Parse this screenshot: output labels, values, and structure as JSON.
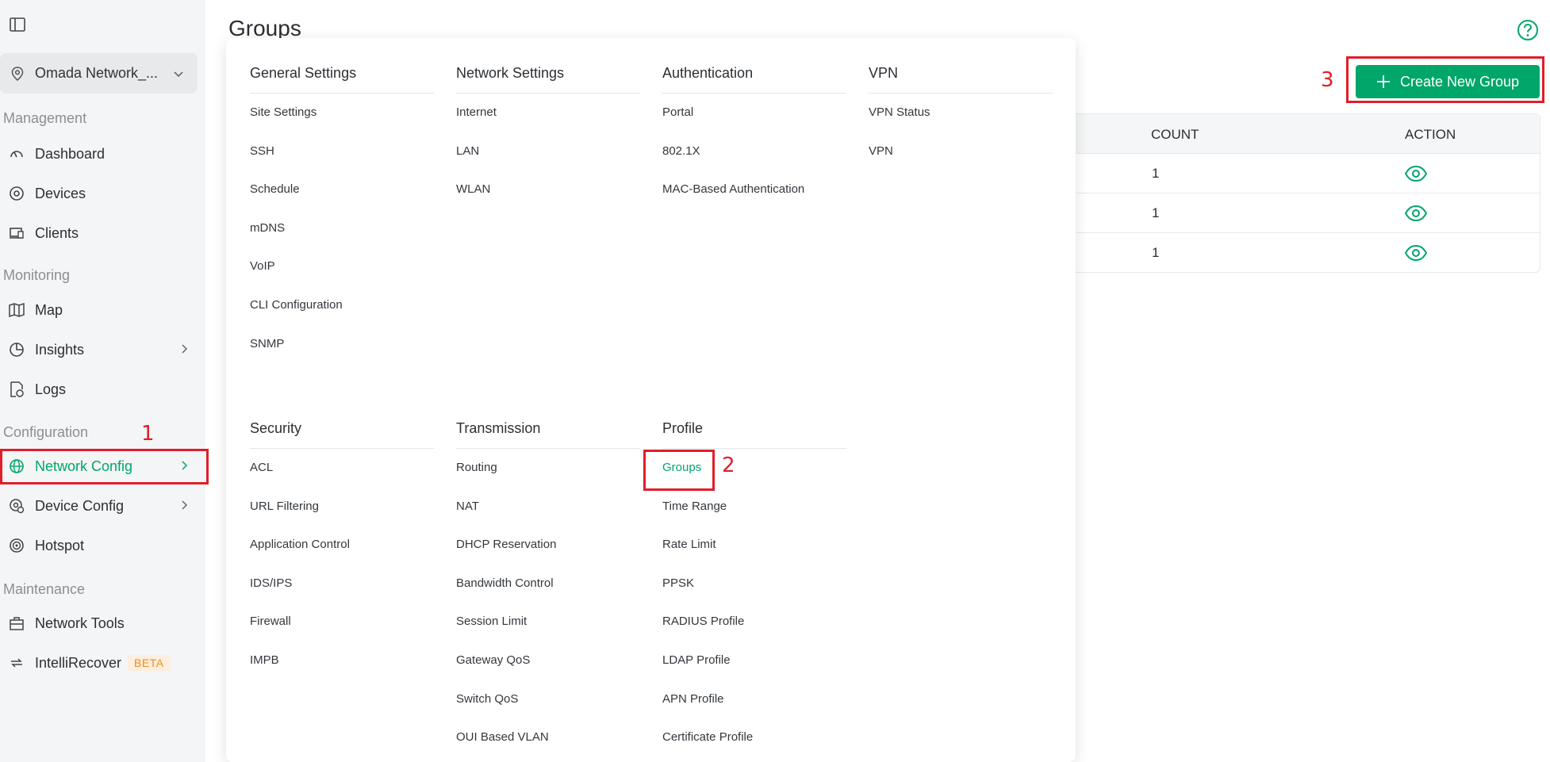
{
  "sidebar": {
    "site_name": "Omada Network_...",
    "sections": {
      "management": "Management",
      "monitoring": "Monitoring",
      "configuration": "Configuration",
      "maintenance": "Maintenance"
    },
    "items": {
      "dashboard": "Dashboard",
      "devices": "Devices",
      "clients": "Clients",
      "map": "Map",
      "insights": "Insights",
      "logs": "Logs",
      "network_config": "Network Config",
      "device_config": "Device Config",
      "hotspot": "Hotspot",
      "network_tools": "Network Tools",
      "intellirecover": "IntelliRecover",
      "beta": "BETA"
    }
  },
  "page": {
    "title": "Groups",
    "create_button": "Create New Group"
  },
  "table": {
    "headers": {
      "count": "COUNT",
      "action": "ACTION"
    },
    "rows": [
      {
        "count": "1"
      },
      {
        "count": "1"
      },
      {
        "count": "1"
      }
    ]
  },
  "menu": {
    "general": {
      "head": "General Settings",
      "items": [
        "Site Settings",
        "SSH",
        "Schedule",
        "mDNS",
        "VoIP",
        "CLI Configuration",
        "SNMP"
      ]
    },
    "network": {
      "head": "Network Settings",
      "items": [
        "Internet",
        "LAN",
        "WLAN"
      ]
    },
    "auth": {
      "head": "Authentication",
      "items": [
        "Portal",
        "802.1X",
        "MAC-Based Authentication"
      ]
    },
    "vpn": {
      "head": "VPN",
      "items": [
        "VPN Status",
        "VPN"
      ]
    },
    "security": {
      "head": "Security",
      "items": [
        "ACL",
        "URL Filtering",
        "Application Control",
        "IDS/IPS",
        "Firewall",
        "IMPB"
      ]
    },
    "transmission": {
      "head": "Transmission",
      "items": [
        "Routing",
        "NAT",
        "DHCP Reservation",
        "Bandwidth Control",
        "Session Limit",
        "Gateway QoS",
        "Switch QoS",
        "OUI Based VLAN"
      ]
    },
    "profile": {
      "head": "Profile",
      "items": [
        "Groups",
        "Time Range",
        "Rate Limit",
        "PPSK",
        "RADIUS Profile",
        "LDAP Profile",
        "APN Profile",
        "Certificate Profile"
      ]
    }
  },
  "annotations": {
    "one": "1",
    "two": "2",
    "three": "3"
  },
  "colors": {
    "accent": "#00a66a",
    "annotation": "#e01e2a"
  }
}
